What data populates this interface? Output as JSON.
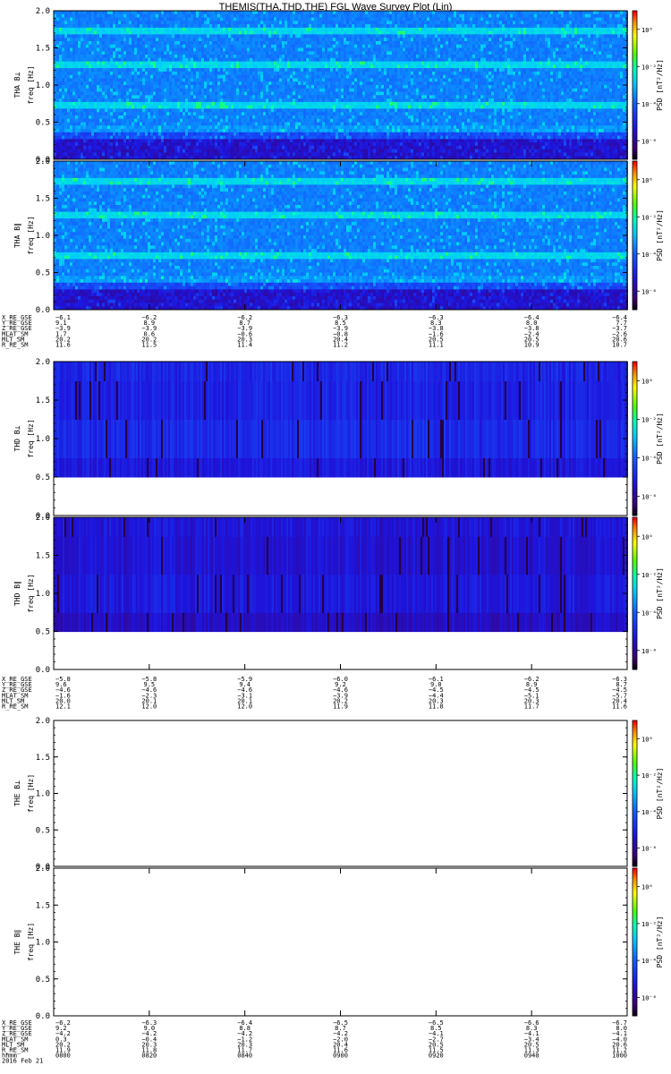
{
  "title": "THEMIS(THA,THD,THE) FGL Wave Survey Plot (Lin)",
  "colorbar_label": "PSD [nT²/Hz]",
  "colorbar_ticks": [
    "10⁰",
    "10⁻²",
    "10⁻⁴",
    "10⁻⁶"
  ],
  "probes": [
    {
      "id": "THA",
      "panels": [
        {
          "label_top": "THA B⊥",
          "label_bottom": "freq [Hz]",
          "freq_range": [
            0.5,
            2.0
          ]
        },
        {
          "label_top": "THA B∥",
          "label_bottom": "freq [Hz]",
          "freq_range": [
            0.5,
            2.0
          ]
        }
      ],
      "ephemeris_labels": [
        "X_RE_GSE",
        "Y_RE_GSE",
        "Z_RE_GSE",
        "MLAT_SM",
        "MLT_SM",
        "R_RE_SM"
      ],
      "ephemeris_rows": [
        [
          "−6.1",
          "−6.2",
          "−6.2",
          "−6.3",
          "−6.3",
          "−6.4",
          "−6.4"
        ],
        [
          "9.1",
          "8.9",
          "8.7",
          "8.5",
          "8.3",
          "8.0",
          "7.7"
        ],
        [
          "−3.9",
          "−3.9",
          "−3.9",
          "−3.9",
          "−3.8",
          "−3.8",
          "−3.7"
        ],
        [
          "1.7",
          "0.6",
          "−0.6",
          "−0.8",
          "−1.6",
          "−2.4",
          "−2.6"
        ],
        [
          "20.2",
          "20.2",
          "20.3",
          "20.4",
          "20.5",
          "20.5",
          "20.6"
        ],
        [
          "11.6",
          "11.5",
          "11.4",
          "11.2",
          "11.1",
          "10.9",
          "10.7"
        ]
      ]
    },
    {
      "id": "THD",
      "panels": [
        {
          "label_top": "THD B⊥",
          "label_bottom": "freq [Hz]",
          "freq_range": [
            0.5,
            2.0
          ]
        },
        {
          "label_top": "THD B∥",
          "label_bottom": "freq [Hz]",
          "freq_range": [
            0.5,
            2.0
          ]
        }
      ],
      "ephemeris_labels": [
        "X_RE_GSE",
        "Y_RE_GSE",
        "Z_RE_GSE",
        "MLAT_SM",
        "MLT_SM",
        "R_RE_SM"
      ],
      "ephemeris_rows": [
        [
          "−5.8",
          "−5.8",
          "−5.9",
          "−6.0",
          "−6.1",
          "−6.2",
          "−6.3"
        ],
        [
          "9.6",
          "9.5",
          "9.4",
          "9.2",
          "9.0",
          "8.9",
          "8.7"
        ],
        [
          "−4.6",
          "−4.6",
          "−4.6",
          "−4.6",
          "−4.5",
          "−4.5",
          "−4.5"
        ],
        [
          "−1.6",
          "−2.3",
          "−3.1",
          "−3.9",
          "−4.4",
          "−5.1",
          "−5.7"
        ],
        [
          "20.0",
          "20.1",
          "20.1",
          "20.2",
          "20.3",
          "20.3",
          "20.4"
        ],
        [
          "12.1",
          "12.0",
          "12.0",
          "11.9",
          "11.8",
          "11.7",
          "11.6"
        ]
      ]
    },
    {
      "id": "THE",
      "panels": [
        {
          "label_top": "THE B⊥",
          "label_bottom": "freq [Hz]",
          "freq_range": null
        },
        {
          "label_top": "THE B∥",
          "label_bottom": "freq [Hz]",
          "freq_range": null
        }
      ],
      "ephemeris_labels": [
        "X_RE_GSE",
        "Y_RE_GSE",
        "Z_RE_GSE",
        "MLAT_SM",
        "MLT_SM",
        "R_RE_SM",
        "hhmm",
        "2016 Feb 21"
      ],
      "ephemeris_rows": [
        [
          "−6.2",
          "−6.3",
          "−6.4",
          "−6.5",
          "−6.5",
          "−6.6",
          "−6.7"
        ],
        [
          "9.2",
          "9.0",
          "8.8",
          "8.7",
          "8.5",
          "8.3",
          "8.0"
        ],
        [
          "−4.2",
          "−4.2",
          "−4.2",
          "−4.2",
          "−4.1",
          "−4.1",
          "−4.1"
        ],
        [
          "0.3",
          "−0.4",
          "−1.2",
          "−2.0",
          "−2.7",
          "−3.4",
          "−4.0"
        ],
        [
          "20.2",
          "20.3",
          "20.3",
          "20.4",
          "20.5",
          "20.5",
          "20.6"
        ],
        [
          "11.9",
          "11.8",
          "11.7",
          "11.6",
          "11.5",
          "11.3",
          "11.2"
        ],
        [
          "0800",
          "0820",
          "0840",
          "0900",
          "0920",
          "0940",
          "1000"
        ]
      ]
    }
  ],
  "chart_data": {
    "type": "heatmap",
    "y_axis_label": "freq [Hz]",
    "y_ticks": [
      "0.0",
      "0.5",
      "1.0",
      "1.5",
      "2.0"
    ],
    "ylim": [
      0.0,
      2.0
    ],
    "x_ticks": [
      "0800",
      "0820",
      "0840",
      "0900",
      "0920",
      "0940",
      "1000"
    ],
    "color_scale": "rainbow",
    "colorbar_range_log10": [
      -7,
      1
    ],
    "date": "2016 Feb 21"
  }
}
